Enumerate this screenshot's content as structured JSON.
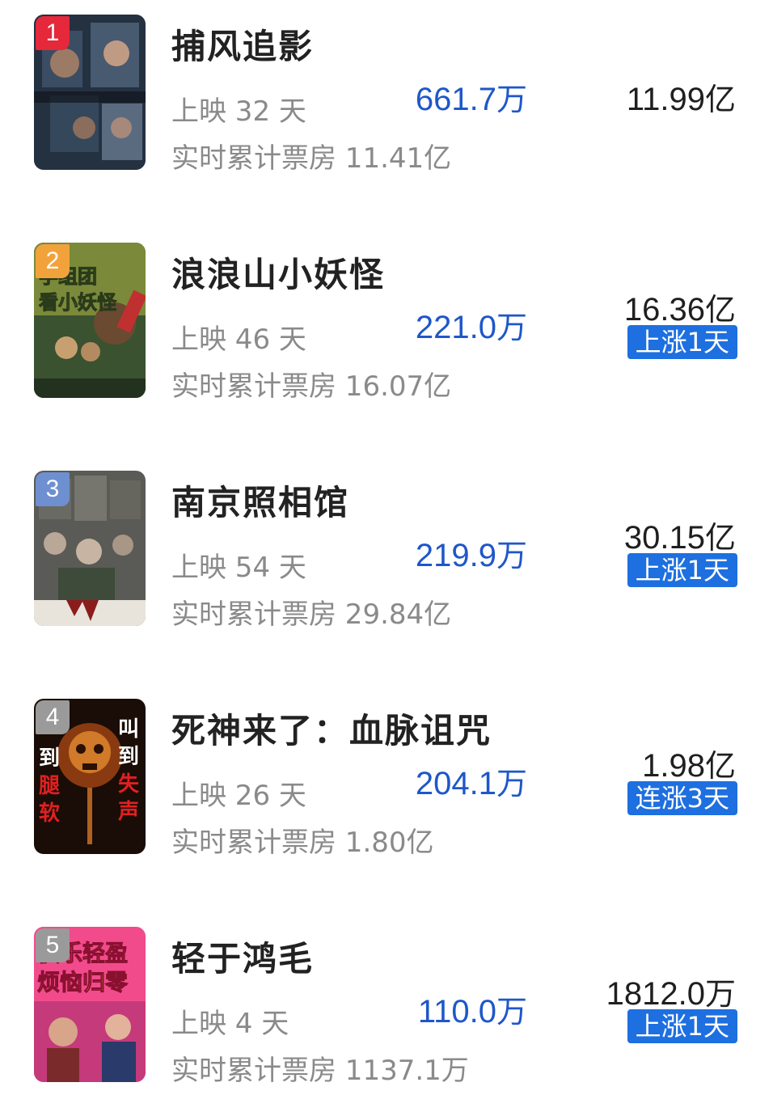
{
  "colors": {
    "box_office_blue": "#1e57c9",
    "badge_blue": "#1e6fe0",
    "rank1": "#e5283a",
    "rank2": "#f2a23b",
    "rank3": "#6e8fd0",
    "rank_other": "#9a9a9a"
  },
  "movies": [
    {
      "rank": "1",
      "title": "捕风追影",
      "days": "上映 32 天",
      "cumulative": "实时累计票房 11.41亿",
      "today_value": "661.7",
      "today_unit": "万",
      "total_value": "11.99",
      "total_unit": "亿",
      "badge": "",
      "poster_icon": "movie-poster-thumbnail"
    },
    {
      "rank": "2",
      "title": "浪浪山小妖怪",
      "days": "上映 46 天",
      "cumulative": "实时累计票房 16.07亿",
      "today_value": "221.0",
      "today_unit": "万",
      "total_value": "16.36",
      "total_unit": "亿",
      "badge": "上涨1天",
      "poster_text": [
        "学组团",
        "看小妖怪"
      ],
      "poster_icon": "movie-poster-thumbnail"
    },
    {
      "rank": "3",
      "title": "南京照相馆",
      "days": "上映 54 天",
      "cumulative": "实时累计票房 29.84亿",
      "today_value": "219.9",
      "today_unit": "万",
      "total_value": "30.15",
      "total_unit": "亿",
      "badge": "上涨1天",
      "poster_icon": "movie-poster-thumbnail"
    },
    {
      "rank": "4",
      "title": "死神来了：血脉诅咒",
      "days": "上映 26 天",
      "cumulative": "实时累计票房 1.80亿",
      "today_value": "204.1",
      "today_unit": "万",
      "total_value": "1.98",
      "total_unit": "亿",
      "badge": "连涨3天",
      "poster_text": [
        "叫",
        "到",
        "失",
        "声",
        "到",
        "腿",
        "软"
      ],
      "poster_icon": "movie-poster-thumbnail"
    },
    {
      "rank": "5",
      "title": "轻于鸿毛",
      "days": "上映 4 天",
      "cumulative": "实时累计票房 1137.1万",
      "today_value": "110.0",
      "today_unit": "万",
      "total_value": "1812.0",
      "total_unit": "万",
      "badge": "上涨1天",
      "poster_text": [
        "快乐轻盈",
        "烦恼归零"
      ],
      "poster_icon": "movie-poster-thumbnail"
    }
  ]
}
